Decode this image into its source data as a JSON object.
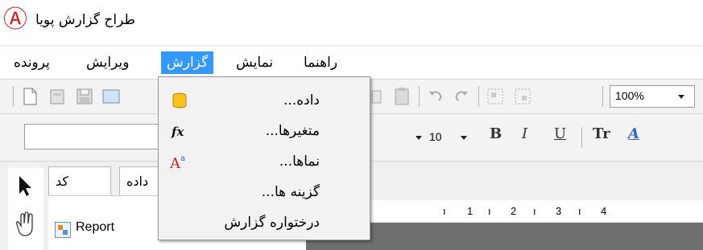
{
  "window": {
    "title": "طراح گزارش پویا",
    "logo_glyph": "Ⓐ",
    "accent_color": "#d8181f"
  },
  "menubar": {
    "items": [
      {
        "label": "پرونده"
      },
      {
        "label": "ویرایش"
      },
      {
        "label": "گزارش",
        "active": true
      },
      {
        "label": "نمایش"
      },
      {
        "label": "راهنما"
      }
    ]
  },
  "toolbar": {
    "zoom_value": "100%",
    "icons": [
      "new-file-icon",
      "open-file-icon",
      "save-icon",
      "preview-icon",
      "copy-icon",
      "paste-icon",
      "undo-icon",
      "redo-icon",
      "group-icon",
      "ungroup-icon"
    ]
  },
  "format_toolbar": {
    "font_size": "10",
    "bold_label": "B",
    "italic_label": "I",
    "underline_label": "U",
    "text_format_label": "Tr",
    "font_color_label": "A"
  },
  "report_menu": {
    "items": [
      {
        "label": "داده...",
        "icon": "database-icon"
      },
      {
        "label": "متغیرها...",
        "icon": "function-icon"
      },
      {
        "label": "نماها...",
        "icon": "styles-icon"
      },
      {
        "label": "گزینه ها...",
        "icon": ""
      },
      {
        "label": "درختواره گزارش",
        "icon": ""
      }
    ]
  },
  "panel": {
    "tabs": [
      {
        "label": "کد"
      },
      {
        "label": "داده"
      }
    ],
    "tree_root": "Report"
  },
  "ruler": {
    "ticks": [
      "1",
      "2",
      "3",
      "4"
    ]
  }
}
